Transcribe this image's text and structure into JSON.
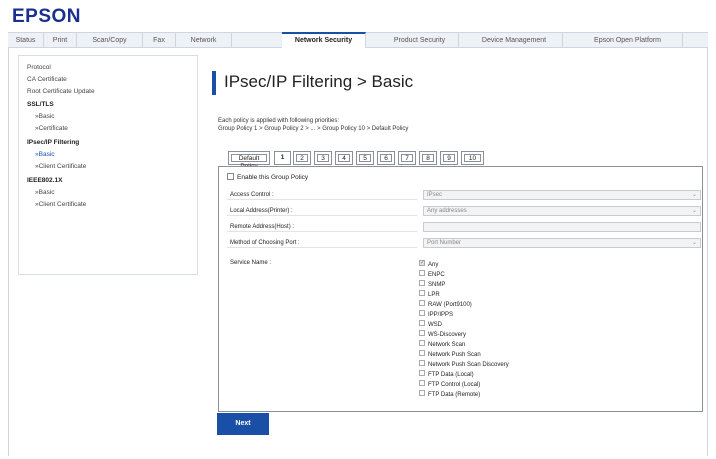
{
  "brand": {
    "logo": "EPSON",
    "color": "#1a2f8f",
    "accent": "#1a4fa8"
  },
  "topnav": {
    "tabs": [
      {
        "label": "Status"
      },
      {
        "label": "Print"
      },
      {
        "label": "Scan/Copy"
      },
      {
        "label": "Fax"
      },
      {
        "label": "Network"
      },
      {
        "label": "Network Security",
        "active": true
      },
      {
        "label": "Product Security"
      },
      {
        "label": "Device Management"
      },
      {
        "label": "Epson Open Platform"
      }
    ]
  },
  "sidebar": {
    "items": [
      {
        "label": "Protocol"
      },
      {
        "label": "CA Certificate"
      },
      {
        "label": "Root Certificate Update"
      },
      {
        "label": "SSL/TLS"
      },
      {
        "label": "»Basic"
      },
      {
        "label": "»Certificate"
      },
      {
        "label": "IPsec/IP Filtering"
      },
      {
        "label": "»Basic",
        "active": true
      },
      {
        "label": "»Client Certificate"
      },
      {
        "label": "IEEE802.1X"
      },
      {
        "label": "»Basic"
      },
      {
        "label": "»Client Certificate"
      }
    ]
  },
  "main": {
    "title": "IPsec/IP Filtering > Basic",
    "description_line1": "Each policy is applied with following priorities:",
    "description_line2": "Group Policy 1 > Group Policy 2 > ... > Group Policy 10 > Default Policy",
    "policy_tabs": [
      "Default Policy",
      "1",
      "2",
      "3",
      "4",
      "5",
      "6",
      "7",
      "8",
      "9",
      "10"
    ],
    "enable_label": "Enable this Group Policy",
    "fields": [
      {
        "label": "Access Control :",
        "value": "IPsec",
        "dropdown": true
      },
      {
        "label": "Local Address(Printer) :",
        "value": "Any addresses",
        "dropdown": true
      },
      {
        "label": "Remote Address(Host) :",
        "value": "",
        "dropdown": false
      },
      {
        "label": "Method of Choosing Port :",
        "value": "Port Number",
        "dropdown": true
      }
    ],
    "service_label": "Service Name :",
    "services": [
      {
        "label": "Any",
        "checked": true
      },
      {
        "label": "ENPC",
        "checked": false
      },
      {
        "label": "SNMP",
        "checked": false
      },
      {
        "label": "LPR",
        "checked": false
      },
      {
        "label": "RAW (Port9100)",
        "checked": false
      },
      {
        "label": "IPP/IPPS",
        "checked": false
      },
      {
        "label": "WSD",
        "checked": false
      },
      {
        "label": "WS-Discovery",
        "checked": false
      },
      {
        "label": "Network Scan",
        "checked": false
      },
      {
        "label": "Network Push Scan",
        "checked": false
      },
      {
        "label": "Network Push Scan Discovery",
        "checked": false
      },
      {
        "label": "FTP Data (Local)",
        "checked": false
      },
      {
        "label": "FTP Control (Local)",
        "checked": false
      },
      {
        "label": "FTP Data (Remote)",
        "checked": false
      }
    ],
    "next_label": "Next"
  }
}
